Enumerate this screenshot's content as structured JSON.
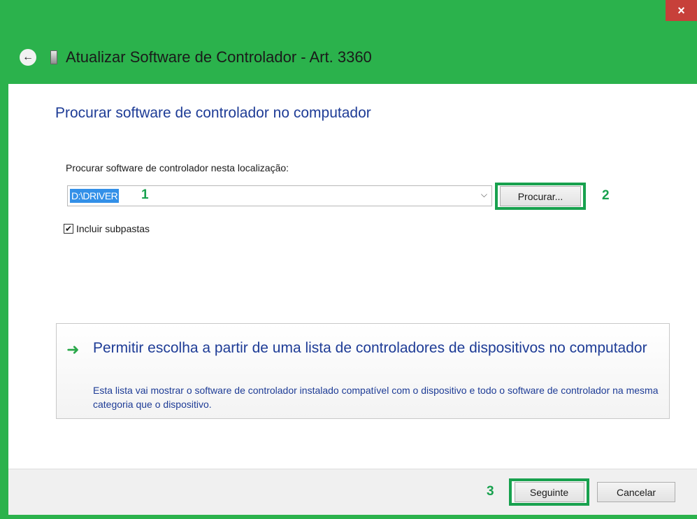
{
  "window": {
    "close_glyph": "×",
    "title": "Atualizar Software de Controlador - Art. 3360",
    "back_glyph": "←",
    "icons": {
      "back": "back-arrow-icon",
      "device": "device-icon",
      "close": "close-icon"
    }
  },
  "main": {
    "heading": "Procurar software de controlador no computador",
    "location_label": "Procurar software de controlador nesta localização:",
    "location_value": "D:\\DRIVER",
    "dropdown_glyph": "⌵",
    "browse_label": "Procurar...",
    "include_subfolders": {
      "checked": true,
      "check_glyph": "✔",
      "label": "Incluir subpastas"
    }
  },
  "option": {
    "arrow_glyph": "➜",
    "title": "Permitir escolha a partir de uma lista de controladores de dispositivos no computador",
    "description": "Esta lista vai mostrar o software de controlador instalado compatível com o dispositivo e todo o software de controlador na mesma categoria que o dispositivo."
  },
  "markers": {
    "m1": "1",
    "m2": "2",
    "m3": "3"
  },
  "footer": {
    "next_label": "Seguinte",
    "cancel_label": "Cancelar"
  },
  "colors": {
    "frame": "#2bb24c",
    "highlight": "#18a14e",
    "link_blue": "#1e3c96",
    "selection": "#3390e8",
    "close": "#c7403a"
  }
}
